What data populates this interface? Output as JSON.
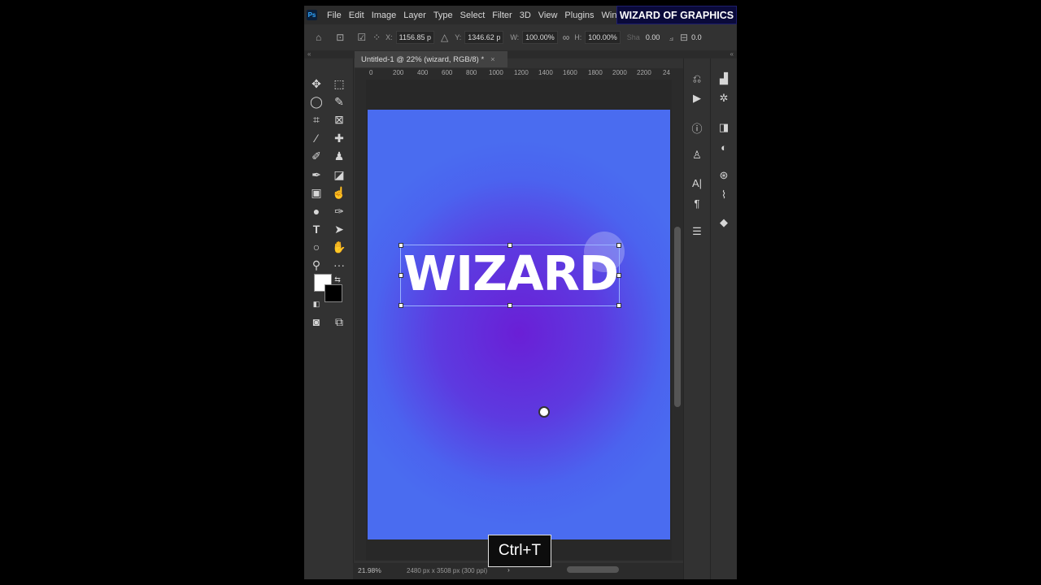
{
  "app": {
    "logo": "Ps"
  },
  "menu": [
    "File",
    "Edit",
    "Image",
    "Layer",
    "Type",
    "Select",
    "Filter",
    "3D",
    "View",
    "Plugins",
    "Windo"
  ],
  "brand_overlay": "WIZARD OF GRAPHICS",
  "options": {
    "x_label": "X:",
    "x_value": "1156.85 p",
    "y_label": "Y:",
    "y_value": "1346.62 p",
    "w_label": "W:",
    "w_value": "100.00%",
    "h_label": "H:",
    "h_value": "100.00%",
    "sh_label": "Sha",
    "sh_value": "0.00",
    "last_value": "0.0"
  },
  "document_tab": {
    "title": "Untitled-1 @ 22% (wizard, RGB/8) *",
    "close": "×"
  },
  "ruler_ticks": [
    "0",
    "200",
    "400",
    "600",
    "800",
    "1000",
    "1200",
    "1400",
    "1600",
    "1800",
    "2000",
    "2200",
    "24"
  ],
  "canvas": {
    "text": "WIZARD"
  },
  "status": {
    "zoom": "21.98%",
    "doc_size": "2480 px x 3508 px (300 ppi)"
  },
  "shortcut_overlay": "Ctrl+T",
  "icons": [
    "home-icon",
    "move-icon",
    "marquee-icon",
    "lasso-icon",
    "quick-select-icon",
    "crop-icon",
    "frame-icon",
    "eyedropper-icon",
    "healing-icon",
    "brush-icon",
    "stamp-icon",
    "history-brush-icon",
    "eraser-icon",
    "gradient-icon",
    "smudge-icon",
    "dodge-icon",
    "pen-icon",
    "type-icon",
    "path-select-icon",
    "ellipse-icon",
    "hand-icon",
    "zoom-icon",
    "more-icon",
    "quickmask-icon",
    "screen-mode-icon"
  ]
}
